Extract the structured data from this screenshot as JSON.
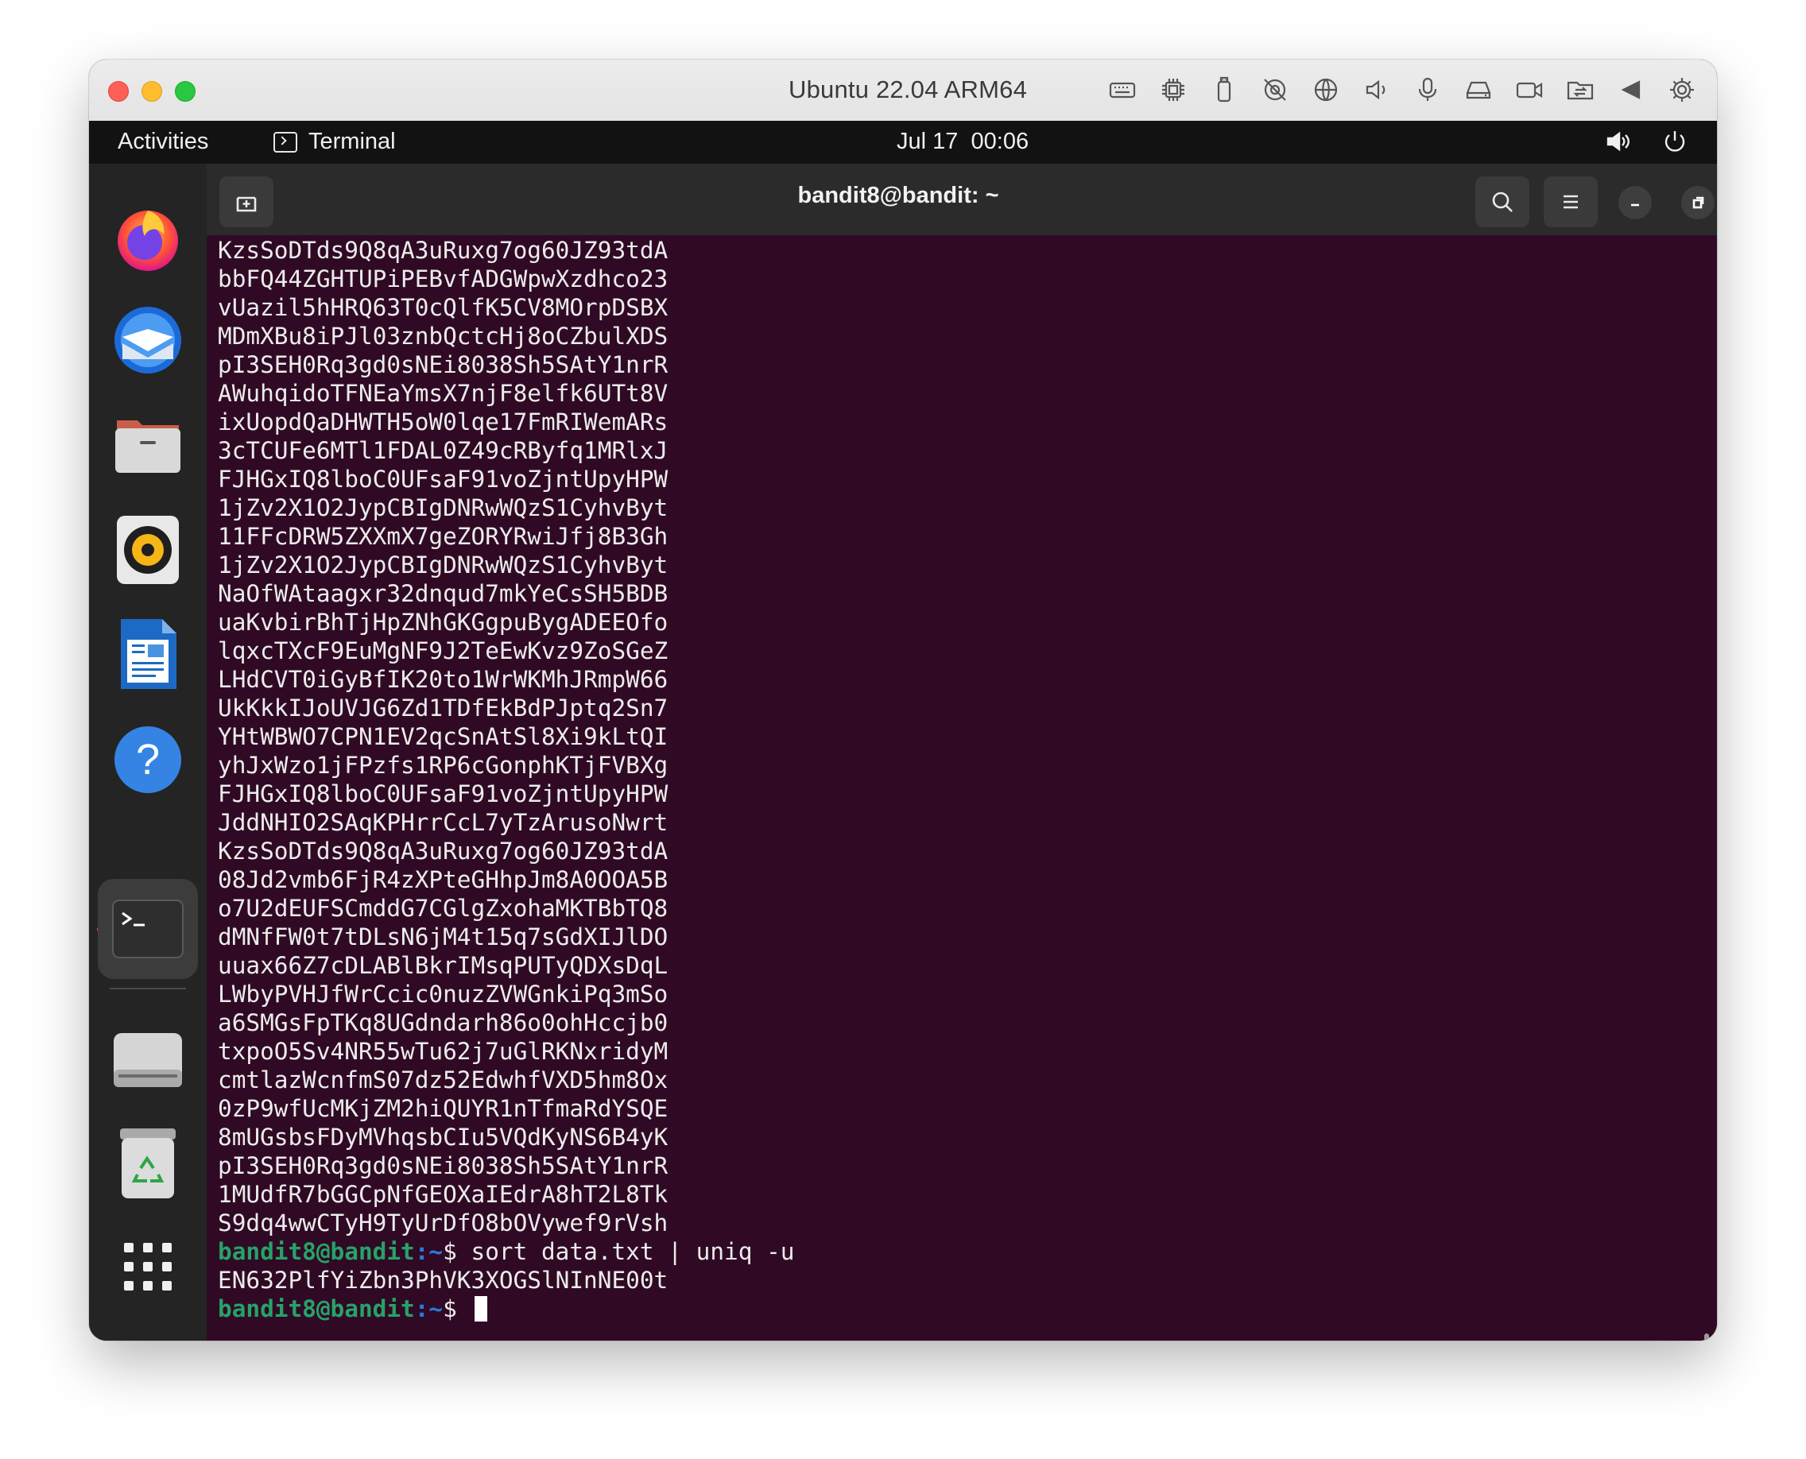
{
  "vm_window": {
    "title": "Ubuntu 22.04 ARM64",
    "toolbar_icons": [
      "keyboard-icon",
      "cpu-icon",
      "usb-icon",
      "camera-off-icon",
      "network-icon",
      "volume-icon",
      "microphone-icon",
      "disk-icon",
      "camera-icon",
      "shared-folders-icon",
      "back-icon",
      "settings-icon"
    ]
  },
  "topbar": {
    "activities": "Activities",
    "app_name": "Terminal",
    "clock": "Jul 17  00:06"
  },
  "dock": {
    "items": [
      "firefox-icon",
      "thunderbird-icon",
      "files-icon",
      "rhythmbox-icon",
      "writer-icon",
      "help-icon",
      "terminal-icon",
      "drive-icon",
      "trash-icon",
      "show-apps-icon"
    ]
  },
  "terminal": {
    "title": "bandit8@bandit: ~",
    "output_lines": [
      "KzsSoDTds9Q8qA3uRuxg7og60JZ93tdA",
      "bbFQ44ZGHTUPiPEBvfADGWpwXzdhco23",
      "vUazil5hHRQ63T0cQlfK5CV8MOrpDSBX",
      "MDmXBu8iPJl03znbQctcHj8oCZbulXDS",
      "pI3SEH0Rq3gd0sNEi8038Sh5SAtY1nrR",
      "AWuhqidoTFNEaYmsX7njF8elfk6UTt8V",
      "ixUopdQaDHWTH5oW0lqe17FmRIWemARs",
      "3cTCUFe6MTl1FDAL0Z49cRByfq1MRlxJ",
      "FJHGxIQ8lboC0UFsaF91voZjntUpyHPW",
      "1jZv2X1O2JypCBIgDNRwWQzS1CyhvByt",
      "11FFcDRW5ZXXmX7geZORYRwiJfj8B3Gh",
      "1jZv2X1O2JypCBIgDNRwWQzS1CyhvByt",
      "NaOfWAtaagxr32dnqud7mkYeCsSH5BDB",
      "uaKvbirBhTjHpZNhGKGgpuBygADEEOfo",
      "lqxcTXcF9EuMgNF9J2TeEwKvz9ZoSGeZ",
      "LHdCVT0iGyBfIK20to1WrWKMhJRmpW66",
      "UkKkkIJoUVJG6Zd1TDfEkBdPJptq2Sn7",
      "YHtWBWO7CPN1EV2qcSnAtSl8Xi9kLtQI",
      "yhJxWzo1jFPzfs1RP6cGonphKTjFVBXg",
      "FJHGxIQ8lboC0UFsaF91voZjntUpyHPW",
      "JddNHIO2SAqKPHrrCcL7yTzArusoNwrt",
      "KzsSoDTds9Q8qA3uRuxg7og60JZ93tdA",
      "08Jd2vmb6FjR4zXPteGHhpJm8A0OOA5B",
      "o7U2dEUFSCmddG7CGlgZxohaMKTBbTQ8",
      "dMNfFW0t7tDLsN6jM4t15q7sGdXIJlDO",
      "uuax66Z7cDLABlBkrIMsqPUTyQDXsDqL",
      "LWbyPVHJfWrCcic0nuzZVWGnkiPq3mSo",
      "a6SMGsFpTKq8UGdndarh86o0ohHccjb0",
      "txpoO5Sv4NR55wTu62j7uGlRKNxridyM",
      "cmtlazWcnfmS07dz52EdwhfVXD5hm8Ox",
      "0zP9wfUcMKjZM2hiQUYR1nTfmaRdYSQE",
      "8mUGsbsFDyMVhqsbCIu5VQdKyNS6B4yK",
      "pI3SEH0Rq3gd0sNEi8038Sh5SAtY1nrR",
      "1MUdfR7bGGCpNfGEOXaIEdrA8hT2L8Tk",
      "S9dq4wwCTyH9TyUrDfO8bOVywef9rVsh"
    ],
    "command_prompt_user": "bandit8@bandit",
    "command_prompt_path": ":~",
    "command_prompt_symbol": "$ ",
    "command": "sort data.txt | uniq -u",
    "result_line": "EN632PlfYiZbn3PhVK3XOGSlNInNE00t",
    "final_prompt_user": "bandit8@bandit",
    "final_prompt_path": ":~",
    "final_prompt_symbol": "$ "
  },
  "colors": {
    "terminal_bg": "#300a24",
    "prompt_user": "#26a269",
    "prompt_path": "#2a7bde",
    "accent": "#e95420"
  }
}
